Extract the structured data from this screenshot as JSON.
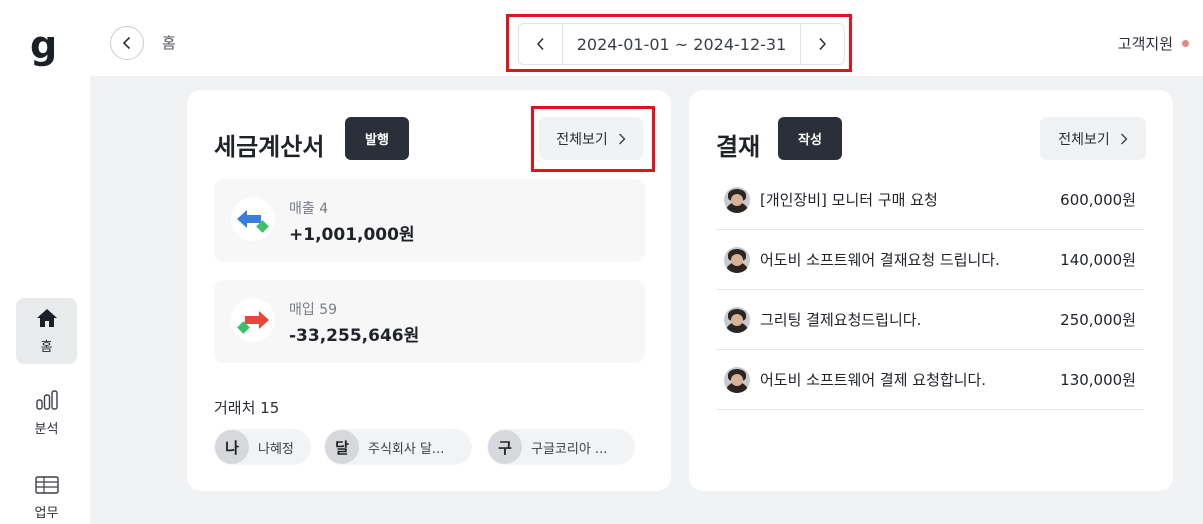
{
  "sidebar": {
    "logo": "g",
    "items": [
      {
        "label": "홈",
        "icon": "home-icon",
        "active": true
      },
      {
        "label": "분석",
        "icon": "bar-chart-icon",
        "active": false
      },
      {
        "label": "업무",
        "icon": "table-icon",
        "active": false
      }
    ]
  },
  "header": {
    "breadcrumb": "홈",
    "date_range": "2024-01-01 ~ 2024-12-31",
    "support_label": "고객지원",
    "support_dot_color": "#e08a80"
  },
  "tax_invoice": {
    "title": "세금계산서",
    "issue_button": "발행",
    "view_all": "전체보기",
    "sales": {
      "label": "매출 4",
      "amount": "+1,001,000원"
    },
    "purchases": {
      "label": "매입 59",
      "amount": "-33,255,646원"
    },
    "partners_title": "거래처 15",
    "partners": [
      {
        "initial": "나",
        "name": "나혜정"
      },
      {
        "initial": "달",
        "name": "주식회사 달..."
      },
      {
        "initial": "구",
        "name": "구글코리아 ..."
      }
    ]
  },
  "payment": {
    "title": "결재",
    "write_button": "작성",
    "view_all": "전체보기",
    "items": [
      {
        "title": "[개인장비] 모니터 구매 요청",
        "amount": "600,000원"
      },
      {
        "title": "어도비 소프트웨어 결재요청 드립니다.",
        "amount": "140,000원"
      },
      {
        "title": "그리팅 결제요청드립니다.",
        "amount": "250,000원"
      },
      {
        "title": "어도비 소프트웨어 결제 요청합니다.",
        "amount": "130,000원"
      }
    ]
  },
  "colors": {
    "highlight": "#e3121b",
    "dark_button": "#2a2f3a",
    "sales_blue": "#3b7ddd",
    "purchase_red": "#e8463b",
    "green": "#3fbf6a"
  }
}
